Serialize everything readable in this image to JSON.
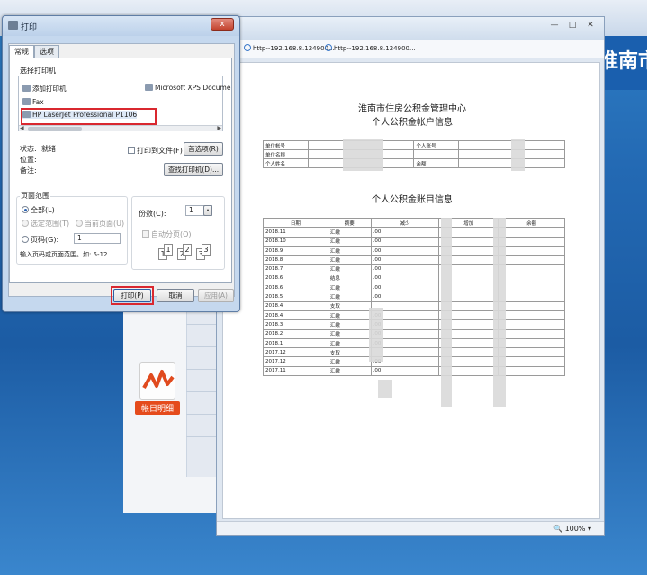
{
  "app": {
    "banner_text": "淮南市",
    "ledger_tile_label": "帐目明细"
  },
  "preview": {
    "tabs": [
      "http--192.168.8.124900...",
      "http--192.168.8.124900..."
    ],
    "zoom": "100%",
    "doc_title_line1": "淮南市住房公积金管理中心",
    "doc_title_line2": "个人公积金帐户信息",
    "ledger_title": "个人公积金账目信息",
    "account_rows": [
      [
        "单位帐号",
        "",
        "个人账号",
        ""
      ],
      [
        "单位名称",
        "",
        "",
        ""
      ],
      [
        "个人姓名",
        "",
        "余额",
        ""
      ]
    ],
    "ledger_headers": [
      "日期",
      "摘要",
      "减少",
      "增加",
      "余额"
    ],
    "ledger_rows": [
      [
        "2018.11",
        "汇缴",
        ".00",
        "",
        ""
      ],
      [
        "2018.10",
        "汇缴",
        ".00",
        "",
        ""
      ],
      [
        "2018.9",
        "汇缴",
        ".00",
        "",
        ""
      ],
      [
        "2018.8",
        "汇缴",
        ".00",
        "",
        ""
      ],
      [
        "2018.7",
        "汇缴",
        ".00",
        "",
        ""
      ],
      [
        "2018.6",
        "结息",
        ".00",
        "",
        ""
      ],
      [
        "2018.6",
        "汇缴",
        ".00",
        "",
        ""
      ],
      [
        "2018.5",
        "汇缴",
        ".00",
        "",
        ""
      ],
      [
        "2018.4",
        "支取",
        "",
        "",
        ""
      ],
      [
        "2018.4",
        "汇缴",
        ".00",
        "",
        ""
      ],
      [
        "2018.3",
        "汇缴",
        ".00",
        "",
        ""
      ],
      [
        "2018.2",
        "汇缴",
        ".00",
        "",
        ""
      ],
      [
        "2018.1",
        "汇缴",
        ".00",
        "",
        ""
      ],
      [
        "2017.12",
        "支取",
        "",
        "",
        ""
      ],
      [
        "2017.12",
        "汇缴",
        ".00",
        "",
        ""
      ],
      [
        "2017.11",
        "汇缴",
        ".00",
        "",
        ""
      ]
    ]
  },
  "dialog": {
    "title": "打印",
    "tab_general": "常规",
    "tab_options": "选项",
    "select_printer_label": "选择打印机",
    "printers": [
      "添加打印机",
      "Microsoft XPS Docume",
      "Fax",
      "HP LaserJet Professional P1106"
    ],
    "status_label": "状态:",
    "status_value": "就绪",
    "location_label": "位置:",
    "comment_label": "备注:",
    "print_to_file": "打印到文件(F)",
    "preferences_button": "首选项(R)",
    "find_printer_button": "查找打印机(D)...",
    "page_range_label": "页面范围",
    "range_all": "全部(L)",
    "range_selection": "选定范围(T)",
    "range_current": "当前页面(U)",
    "range_pages": "页码(G):",
    "pages_value": "1",
    "pages_hint": "输入页码或页面范围。如: 5-12",
    "copies_label": "份数(C):",
    "copies_value": "1",
    "collate_label": "自动分页(O)",
    "print_button": "打印(P)",
    "cancel_button": "取消",
    "apply_button": "应用(A)",
    "close_glyph": "x"
  }
}
